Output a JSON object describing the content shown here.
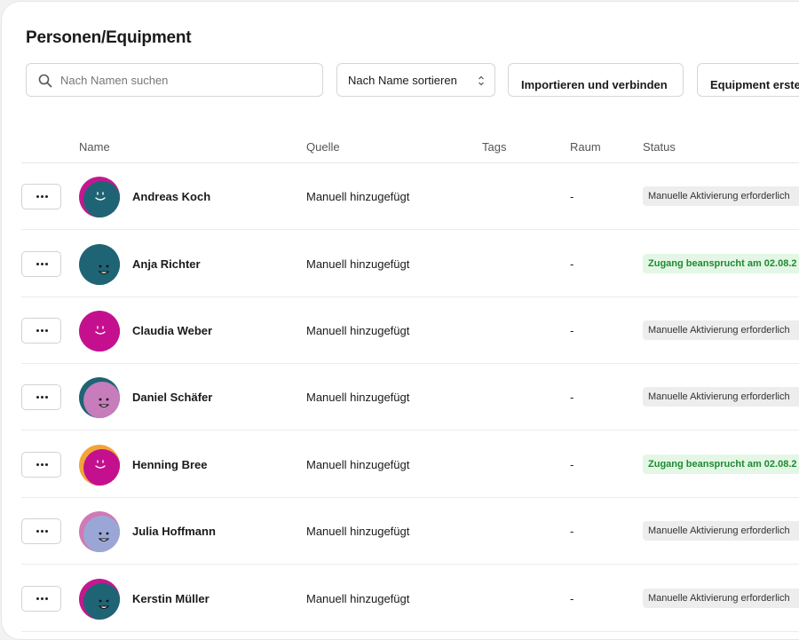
{
  "page": {
    "title": "Personen/Equipment"
  },
  "toolbar": {
    "search_placeholder": "Nach Namen suchen",
    "search_value": "",
    "sort_label": "Nach Name sortieren",
    "import_label": "Importieren und verbinden",
    "create_label": "Equipment erste"
  },
  "columns": {
    "name": "Name",
    "source": "Quelle",
    "tags": "Tags",
    "room": "Raum",
    "status": "Status"
  },
  "colors": {
    "status_gray_bg": "#ededed",
    "status_green_bg": "#e4f7e6",
    "status_green_text": "#1f8a2f"
  },
  "rows": [
    {
      "name": "Andreas Koch",
      "source": "Manuell hinzugefügt",
      "tags": "",
      "room": "-",
      "status": "Manuelle Aktivierung erforderlich",
      "status_kind": "gray",
      "avatar": [
        "#c2198f",
        "#1f6475"
      ]
    },
    {
      "name": "Anja Richter",
      "source": "Manuell hinzugefügt",
      "tags": "",
      "room": "-",
      "status": "Zugang beansprucht am 02.08.2",
      "status_kind": "green",
      "avatar": [
        "#1f6475",
        "#1f6475"
      ]
    },
    {
      "name": "Claudia Weber",
      "source": "Manuell hinzugefügt",
      "tags": "",
      "room": "-",
      "status": "Manuelle Aktivierung erforderlich",
      "status_kind": "gray",
      "avatar": [
        "#c4108f",
        "#c4108f"
      ]
    },
    {
      "name": "Daniel Schäfer",
      "source": "Manuell hinzugefügt",
      "tags": "",
      "room": "-",
      "status": "Manuelle Aktivierung erforderlich",
      "status_kind": "gray",
      "avatar": [
        "#1f6475",
        "#c77cbb"
      ]
    },
    {
      "name": "Henning Bree",
      "source": "Manuell hinzugefügt",
      "tags": "",
      "room": "-",
      "status": "Zugang beansprucht am 02.08.2",
      "status_kind": "green",
      "avatar": [
        "#f2a43a",
        "#c4108f"
      ]
    },
    {
      "name": "Julia Hoffmann",
      "source": "Manuell hinzugefügt",
      "tags": "",
      "room": "-",
      "status": "Manuelle Aktivierung erforderlich",
      "status_kind": "gray",
      "avatar": [
        "#d07ab5",
        "#9aa7d6"
      ]
    },
    {
      "name": "Kerstin Müller",
      "source": "Manuell hinzugefügt",
      "tags": "",
      "room": "-",
      "status": "Manuelle Aktivierung erforderlich",
      "status_kind": "gray",
      "avatar": [
        "#c2198f",
        "#1f6475"
      ]
    }
  ]
}
